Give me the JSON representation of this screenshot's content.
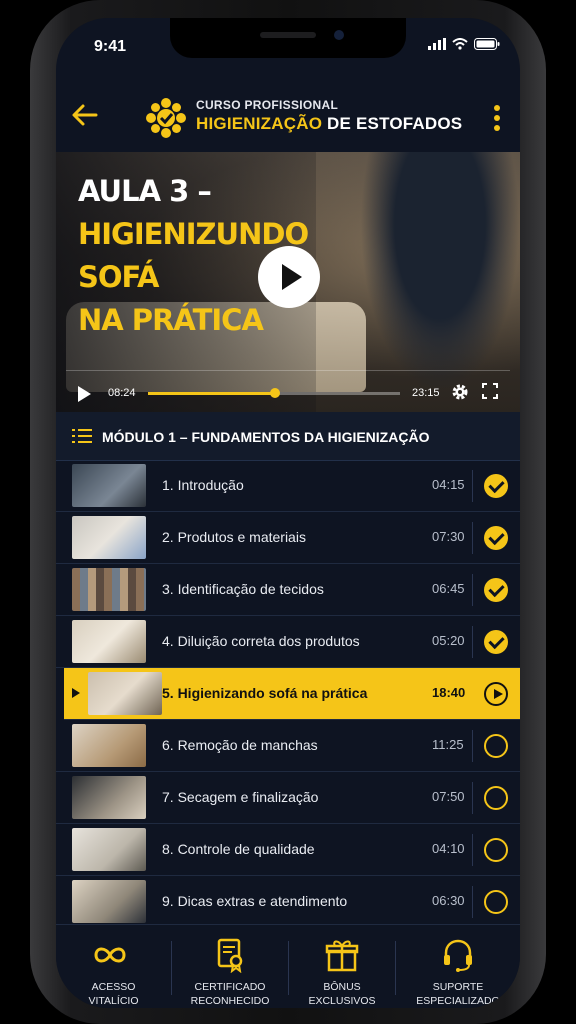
{
  "status": {
    "time": "9:41"
  },
  "header": {
    "subtitle": "CURSO PROFISSIONAL",
    "title_highlight": "HIGIENIZAÇÃO",
    "title_rest": " DE ESTOFADOS"
  },
  "video": {
    "line1": "AULA 3 –",
    "line2": "HIGIENIZUNDO",
    "line3": "SOFÁ",
    "line4": "NA PRÁTICA",
    "current_time": "08:24",
    "duration": "23:15",
    "progress": 0.505
  },
  "module": {
    "title": "MÓDULO 1 – FUNDAMENTOS DA HIGIENIZAÇÃO"
  },
  "lessons": [
    {
      "label": "1. Introdução",
      "duration": "04:15",
      "status": "done"
    },
    {
      "label": "2. Produtos e materiais",
      "duration": "07:30",
      "status": "done"
    },
    {
      "label": "3. Identificação de tecidos",
      "duration": "06:45",
      "status": "done"
    },
    {
      "label": "4. Diluição correta dos produtos",
      "duration": "05:20",
      "status": "done"
    },
    {
      "label": "5. Higienizando sofá na prática",
      "duration": "18:40",
      "status": "playing"
    },
    {
      "label": "6. Remoção de manchas",
      "duration": "11:25",
      "status": "todo"
    },
    {
      "label": "7. Secagem e finalização",
      "duration": "07:50",
      "status": "todo"
    },
    {
      "label": "8. Controle de qualidade",
      "duration": "04:10",
      "status": "todo"
    },
    {
      "label": "9. Dicas extras e atendimento",
      "duration": "06:30",
      "status": "todo"
    }
  ],
  "features": [
    {
      "line1": "ACESSO",
      "line2": "VITALÍCIO",
      "icon": "infinity-icon"
    },
    {
      "line1": "CERTIFICADO",
      "line2": "RECONHECIDO",
      "icon": "certificate-icon"
    },
    {
      "line1": "BÔNUS",
      "line2": "EXCLUSIVOS",
      "icon": "gift-icon"
    },
    {
      "line1": "SUPORTE",
      "line2": "ESPECIALIZADO",
      "icon": "headset-icon"
    }
  ],
  "colors": {
    "accent": "#f5c518",
    "background": "#0e1422"
  }
}
